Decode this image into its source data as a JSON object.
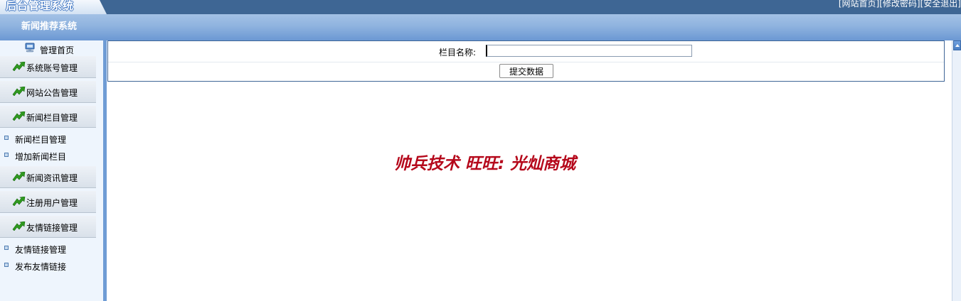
{
  "header": {
    "logo_text": "后台管理系统",
    "links": [
      "[网站首页]",
      "[修改密码]",
      "[安全退出]"
    ],
    "system_title": "新闻推荐系统"
  },
  "sidebar": {
    "home_label": "管理首页",
    "home_icon": "computer-icon",
    "sections": [
      {
        "label": "系统账号管理",
        "icon": "green-arrow-icon"
      },
      {
        "label": "网站公告管理",
        "icon": "green-arrow-icon"
      },
      {
        "label": "新闻栏目管理",
        "icon": "green-arrow-icon",
        "children": [
          "新闻栏目管理",
          "增加新闻栏目"
        ]
      },
      {
        "label": "新闻资讯管理",
        "icon": "green-arrow-icon"
      },
      {
        "label": "注册用户管理",
        "icon": "green-arrow-icon"
      },
      {
        "label": "友情链接管理",
        "icon": "green-arrow-icon",
        "children": [
          "友情链接管理",
          "发布友情链接"
        ]
      }
    ]
  },
  "form": {
    "field_label": "栏目名称:",
    "field_value": "",
    "submit_label": "提交数据"
  },
  "watermark": "帅兵技术 旺旺: 光灿商城",
  "colors": {
    "topbar": "#3e6694",
    "sidebar_bg": "#eef5fd",
    "sidebar_stripe": "#6f9cd5",
    "form_border": "#3f6596",
    "watermark": "#b5081b"
  }
}
